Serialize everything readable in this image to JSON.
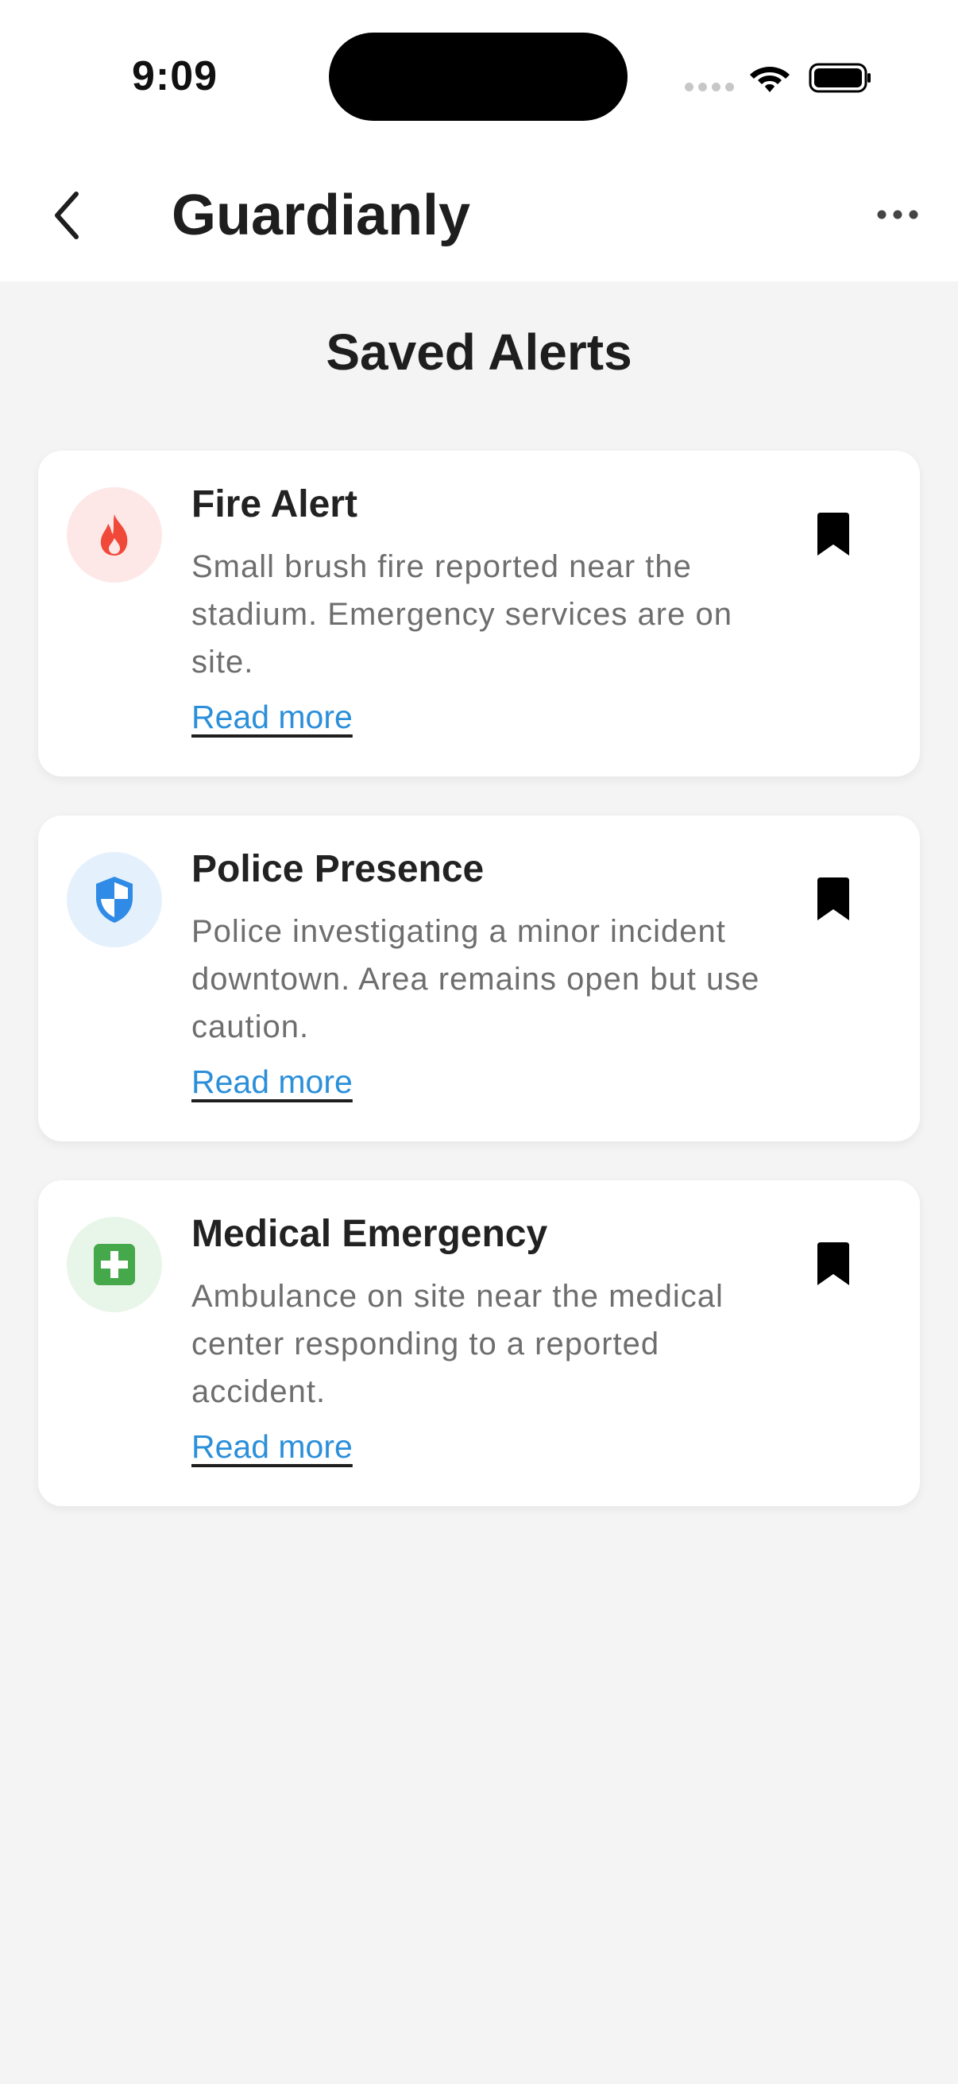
{
  "status_bar": {
    "time": "9:09",
    "icons": [
      "signal-icon",
      "wifi-icon",
      "battery-icon"
    ]
  },
  "header": {
    "app_title": "Guardianly",
    "back_icon": "chevron-left-icon",
    "more_icon": "more-horizontal-icon"
  },
  "page": {
    "title": "Saved Alerts"
  },
  "alerts": [
    {
      "title": "Fire Alert",
      "description": "Small brush fire reported near the stadium. Emergency services are on site.",
      "link": "Read more",
      "icon": "fire-icon",
      "icon_color": "#f0493a",
      "icon_bg": "#fde8e7"
    },
    {
      "title": "Police Presence",
      "description": "Police investigating a minor incident downtown. Area remains open but use caution.",
      "link": "Read more",
      "icon": "shield-icon",
      "icon_color": "#2f8be6",
      "icon_bg": "#e4f1fd"
    },
    {
      "title": "Medical Emergency",
      "description": "Ambulance on site near the medical center responding to a reported accident.",
      "link": "Read more",
      "icon": "medical-cross-icon",
      "icon_color": "#45a84a",
      "icon_bg": "#e8f5e9"
    }
  ],
  "colors": {
    "link": "#2b8fd9",
    "background": "#f4f4f5",
    "card": "#ffffff"
  }
}
